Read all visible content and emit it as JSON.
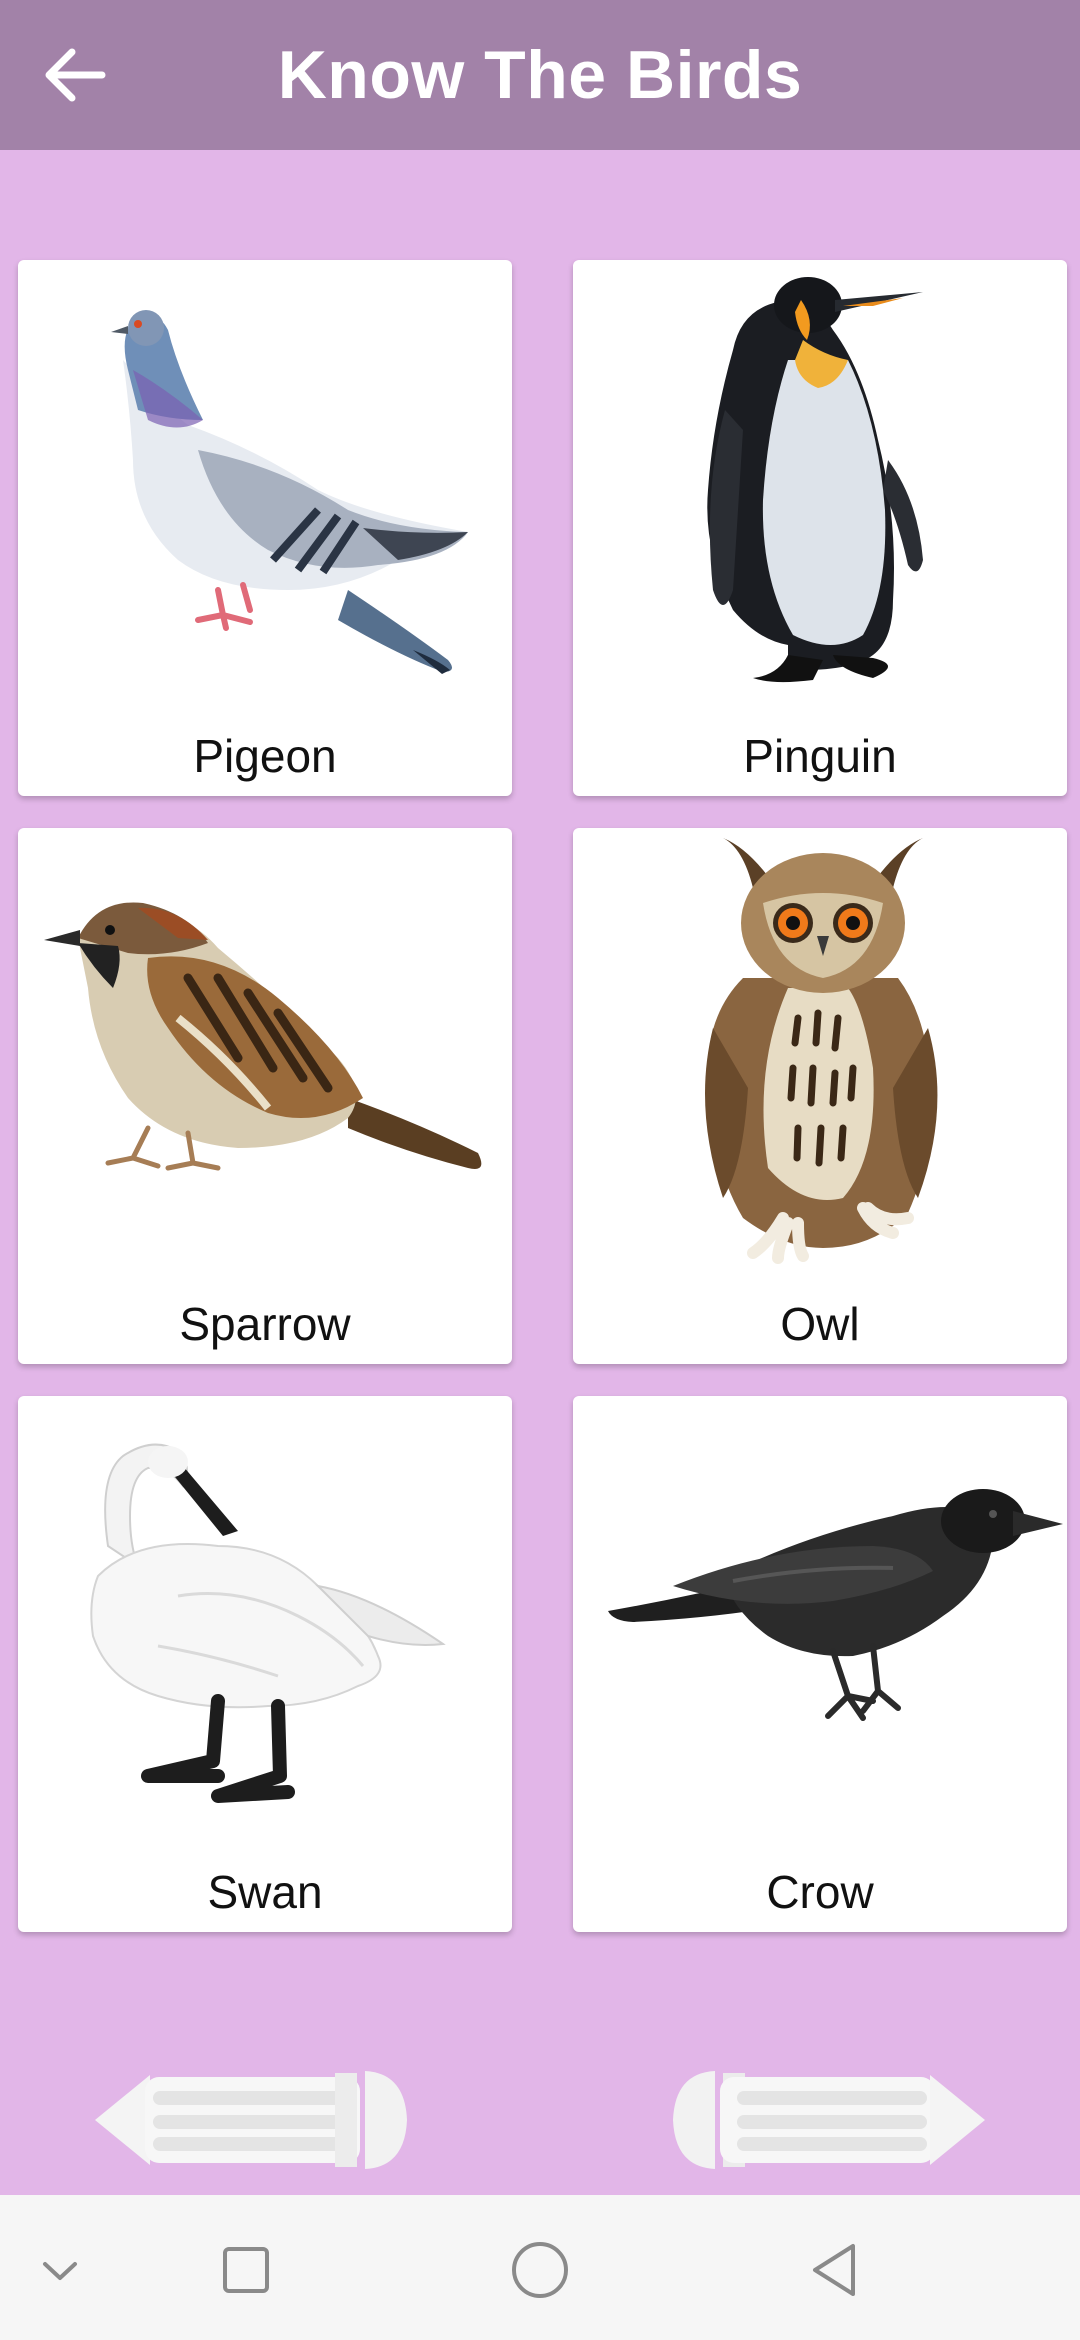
{
  "app_bar": {
    "title": "Know The Birds",
    "back_icon": "arrow-left-icon"
  },
  "colors": {
    "app_bar": "#a282a8",
    "background": "#e2b6e8",
    "card": "#ffffff",
    "system_nav": "#f6f6f6"
  },
  "birds": [
    {
      "name": "Pigeon",
      "icon": "pigeon-image"
    },
    {
      "name": "Pinguin",
      "icon": "penguin-image"
    },
    {
      "name": "Sparrow",
      "icon": "sparrow-image"
    },
    {
      "name": "Owl",
      "icon": "owl-image"
    },
    {
      "name": "Swan",
      "icon": "swan-image"
    },
    {
      "name": "Crow",
      "icon": "crow-image"
    }
  ],
  "pager": {
    "previous_icon": "pencil-arrow-left-icon",
    "next_icon": "pencil-arrow-right-icon"
  },
  "system_nav": {
    "icons": [
      "chevron-down-icon",
      "recent-apps-icon",
      "home-icon",
      "back-triangle-icon"
    ]
  }
}
